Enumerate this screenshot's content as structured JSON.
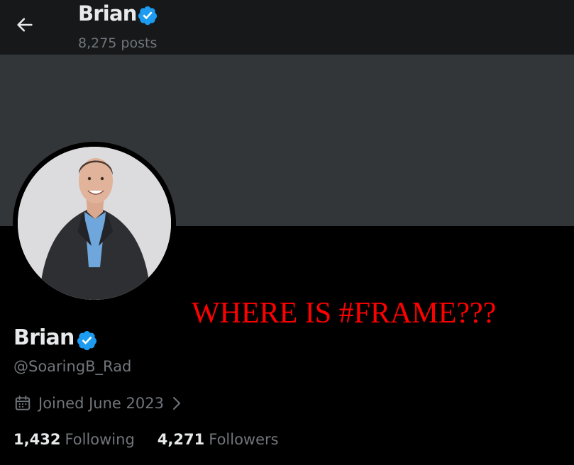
{
  "header": {
    "name": "Brian",
    "posts": "8,275 posts",
    "back_icon": "arrow-left-icon",
    "verified_icon": "verified-badge-icon"
  },
  "profile": {
    "name": "Brian",
    "handle": "@SoaringB_Rad",
    "joined": "Joined June 2023",
    "following_count": "1,432",
    "following_label": "Following",
    "followers_count": "4,271",
    "followers_label": "Followers",
    "calendar_icon": "calendar-icon",
    "chevron_icon": "chevron-right-icon"
  },
  "annotation": {
    "text": "WHERE IS #FRAME???"
  },
  "colors": {
    "background": "#000000",
    "header_bg": "#16181a",
    "banner_bg": "#333639",
    "text_primary": "#e7e9ea",
    "text_secondary": "#71767b",
    "verified_blue": "#1d9bf0",
    "annotation_red": "#ff0000"
  }
}
